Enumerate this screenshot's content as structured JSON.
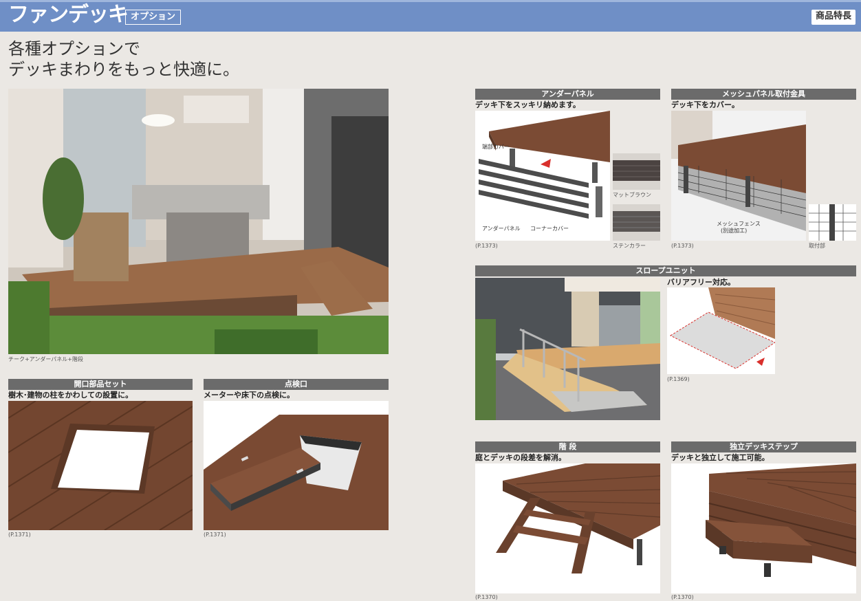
{
  "header": {
    "title": "ファンデッキ",
    "subtitle": "オプション",
    "badge": "商品特長"
  },
  "headline": "各種オプションで\nデッキまわりをもっと快適に。",
  "main_photo": {
    "caption": "チーク+アンダーパネル+階段"
  },
  "sections": {
    "under_panel": {
      "title": "アンダーパネル",
      "desc": "デッキ下をスッキリ納めます。",
      "ref": "(P.1373)",
      "labels": {
        "end_cover": "端部カバー",
        "under_panel": "アンダーパネル",
        "corner_cover": "コーナーカバー",
        "mat_brown": "マットブラウン",
        "stain_color": "ステンカラー"
      }
    },
    "mesh_panel": {
      "title": "メッシュパネル取付金具",
      "desc": "デッキ下をカバー。",
      "ref": "(P.1373)",
      "labels": {
        "mesh_fence": "メッシュフェンス",
        "mesh_note": "(別途加工)",
        "mount": "取付部"
      }
    },
    "slope": {
      "title": "スロープユニット",
      "desc": "バリアフリー対応。",
      "ref": "(P.1369)"
    },
    "opening": {
      "title": "開口部品セット",
      "desc": "樹木･建物の柱をかわしての設置に。",
      "ref": "(P.1371)"
    },
    "inspection": {
      "title": "点検口",
      "desc": "メーターや床下の点検に。",
      "ref": "(P.1371)"
    },
    "stairs": {
      "title": "階 段",
      "desc": "庭とデッキの段差を解消。",
      "ref": "(P.1370)"
    },
    "step": {
      "title": "独立デッキステップ",
      "desc": "デッキと独立して施工可能。",
      "ref": "(P.1370)"
    }
  },
  "colors": {
    "header": "#6f8fc6",
    "section_bar": "#6b6b6b",
    "wood": "#7a4b34",
    "background": "#ebe8e4"
  }
}
